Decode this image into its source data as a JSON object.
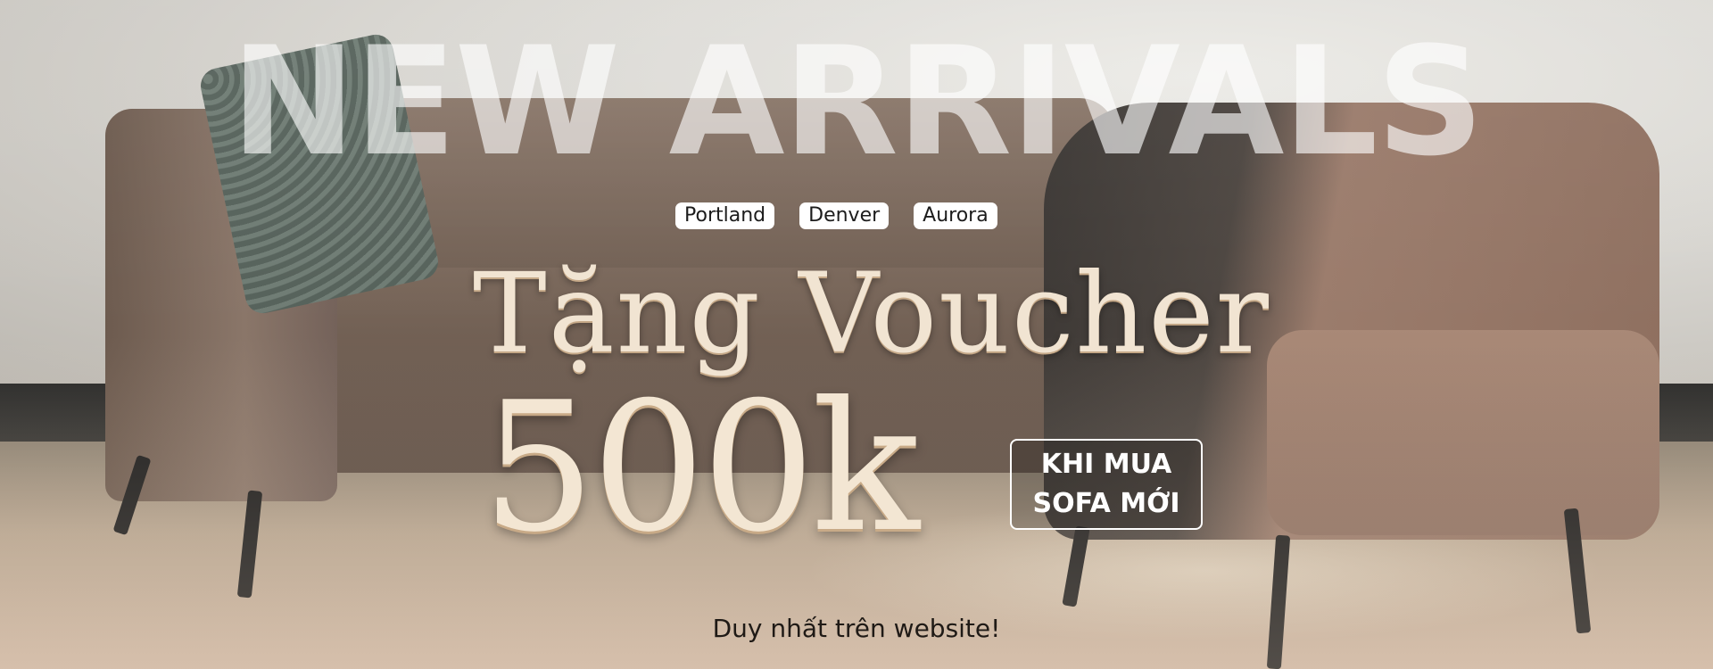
{
  "banner": {
    "headline": "NEW ARRIVALS",
    "cities": [
      "Portland",
      "Denver",
      "Aurora"
    ],
    "voucher_title": "Tặng Voucher",
    "voucher_amount": "500k",
    "condition_line1": "KHI MUA",
    "condition_line2": "SOFA MỚI",
    "tagline": "Duy nhất trên website!"
  }
}
